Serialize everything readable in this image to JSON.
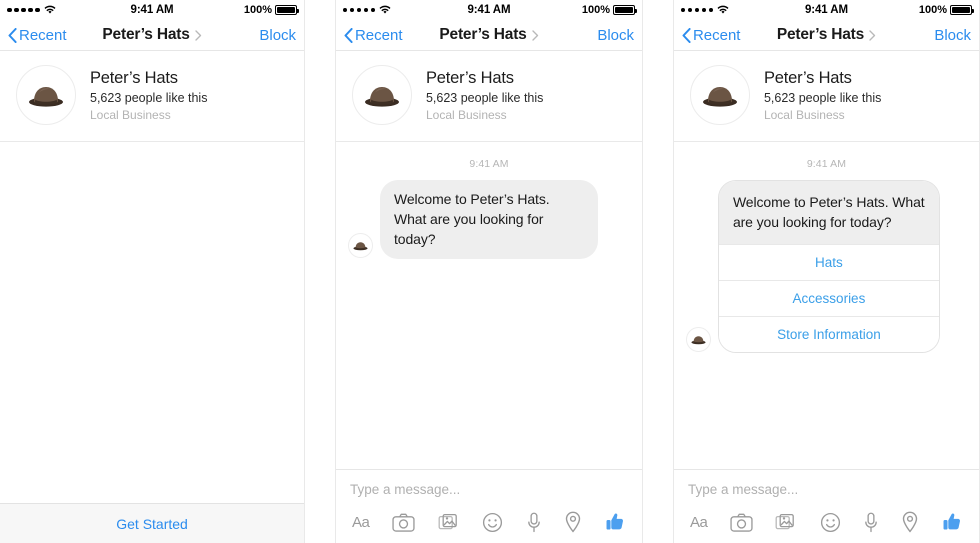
{
  "status_bar": {
    "signal_dots": 5,
    "wifi_icon": "wifi-icon",
    "time": "9:41 AM",
    "battery_percent": "100%",
    "battery_icon": "battery-full-icon"
  },
  "nav_bar": {
    "back_label": "Recent",
    "back_icon": "chevron-left-icon",
    "title": "Peter’s Hats",
    "title_chevron_icon": "chevron-right-icon",
    "action_label": "Block"
  },
  "profile": {
    "avatar_icon": "bowler-hat-avatar",
    "name": "Peter’s Hats",
    "likes": "5,623 people like this",
    "category": "Local Business"
  },
  "conversation": {
    "timestamp": "9:41 AM",
    "bot_avatar_icon": "bowler-hat-mini-avatar",
    "message": "Welcome to Peter’s Hats. What are you looking for today?",
    "quick_replies": [
      "Hats",
      "Accessories",
      "Store Information"
    ]
  },
  "get_started": {
    "label": "Get Started"
  },
  "composer": {
    "placeholder": "Type a message...",
    "icons": [
      "text-format-icon",
      "camera-icon",
      "photo-gallery-icon",
      "emoji-smiley-icon",
      "microphone-icon",
      "location-pin-icon",
      "thumbs-up-icon"
    ]
  },
  "colors": {
    "accent_blue": "#2b8cee",
    "quick_reply_blue": "#3b9fe8",
    "bubble_gray": "#eeeeee",
    "muted_gray": "#b3b3b3",
    "hat_brown": "#6b5544"
  }
}
